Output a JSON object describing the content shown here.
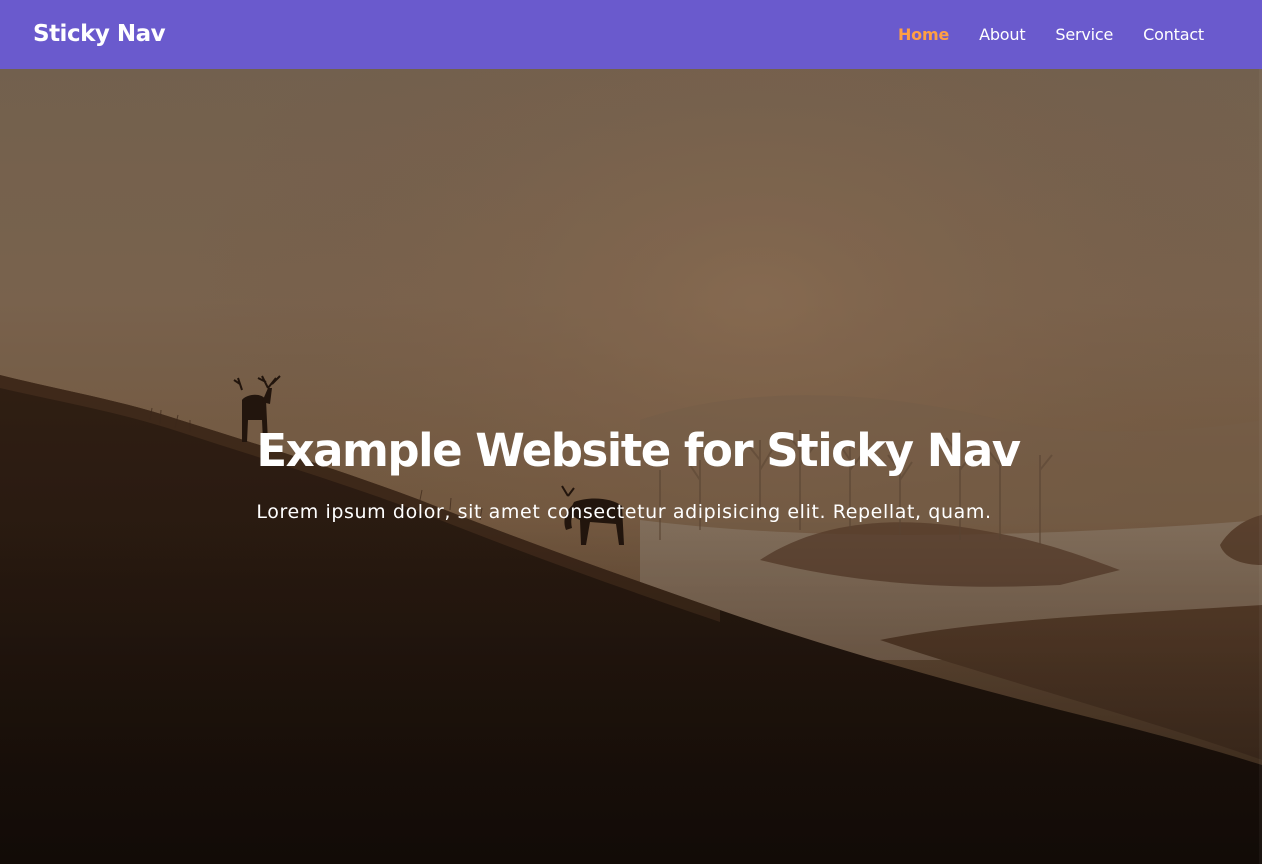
{
  "navbar": {
    "brand": "Sticky Nav",
    "background_color": "#6a5acd",
    "active_color": "#ff9f43",
    "links": [
      {
        "label": "Home",
        "active": true
      },
      {
        "label": "About",
        "active": false
      },
      {
        "label": "Service",
        "active": false
      },
      {
        "label": "Contact",
        "active": false
      }
    ]
  },
  "hero": {
    "title": "Example Website for Sticky Nav",
    "subtitle": "Lorem ipsum dolor, sit amet consectetur adipisicing elit. Repellat, quam."
  }
}
